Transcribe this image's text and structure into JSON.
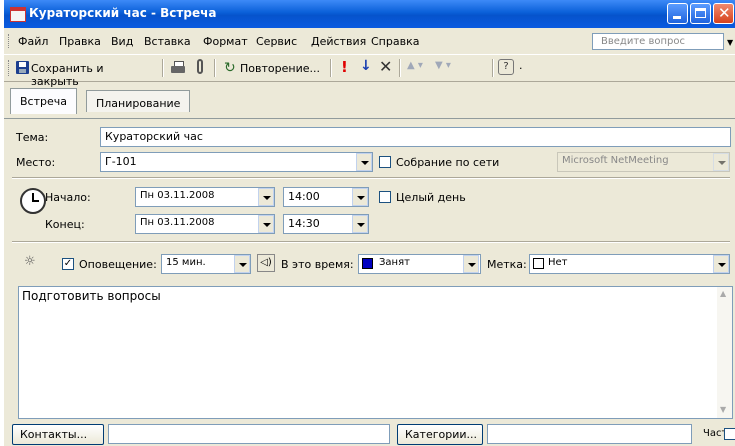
{
  "window": {
    "title": "Кураторский час - Встреча"
  },
  "menu": {
    "items": [
      "Файл",
      "Правка",
      "Вид",
      "Вставка",
      "Формат",
      "Сервис",
      "Действия",
      "Справка"
    ],
    "question_placeholder": "Введите вопрос"
  },
  "toolbar": {
    "save_close_label": "Сохранить и закрыть",
    "recurrence_label": "Повторение..."
  },
  "tabs": [
    {
      "label": "Встреча",
      "active": true
    },
    {
      "label": "Планирование",
      "active": false
    }
  ],
  "form": {
    "subject_label": "Тема:",
    "subject_value": "Кураторский час",
    "location_label": "Место:",
    "location_value": "Г-101",
    "online_meeting_label": "Собрание по сети",
    "online_meeting_checked": false,
    "netmeeting_value": "Microsoft NetMeeting",
    "start_label": "Начало:",
    "start_date": "Пн 03.11.2008",
    "start_time": "14:00",
    "all_day_label": "Целый день",
    "all_day_checked": false,
    "end_label": "Конец:",
    "end_date": "Пн 03.11.2008",
    "end_time": "14:30",
    "reminder_label": "Оповещение:",
    "reminder_checked": true,
    "reminder_value": "15 мин.",
    "show_as_label": "В это время:",
    "show_as_value": "Занят",
    "show_as_color": "#0000c0",
    "label_label": "Метка:",
    "label_value": "Нет",
    "notes": "Подготовить вопросы"
  },
  "bottom": {
    "contacts_label": "Контакты...",
    "contacts_value": "",
    "categories_label": "Категории...",
    "categories_value": "",
    "private_label": "Частное",
    "private_checked": false
  }
}
